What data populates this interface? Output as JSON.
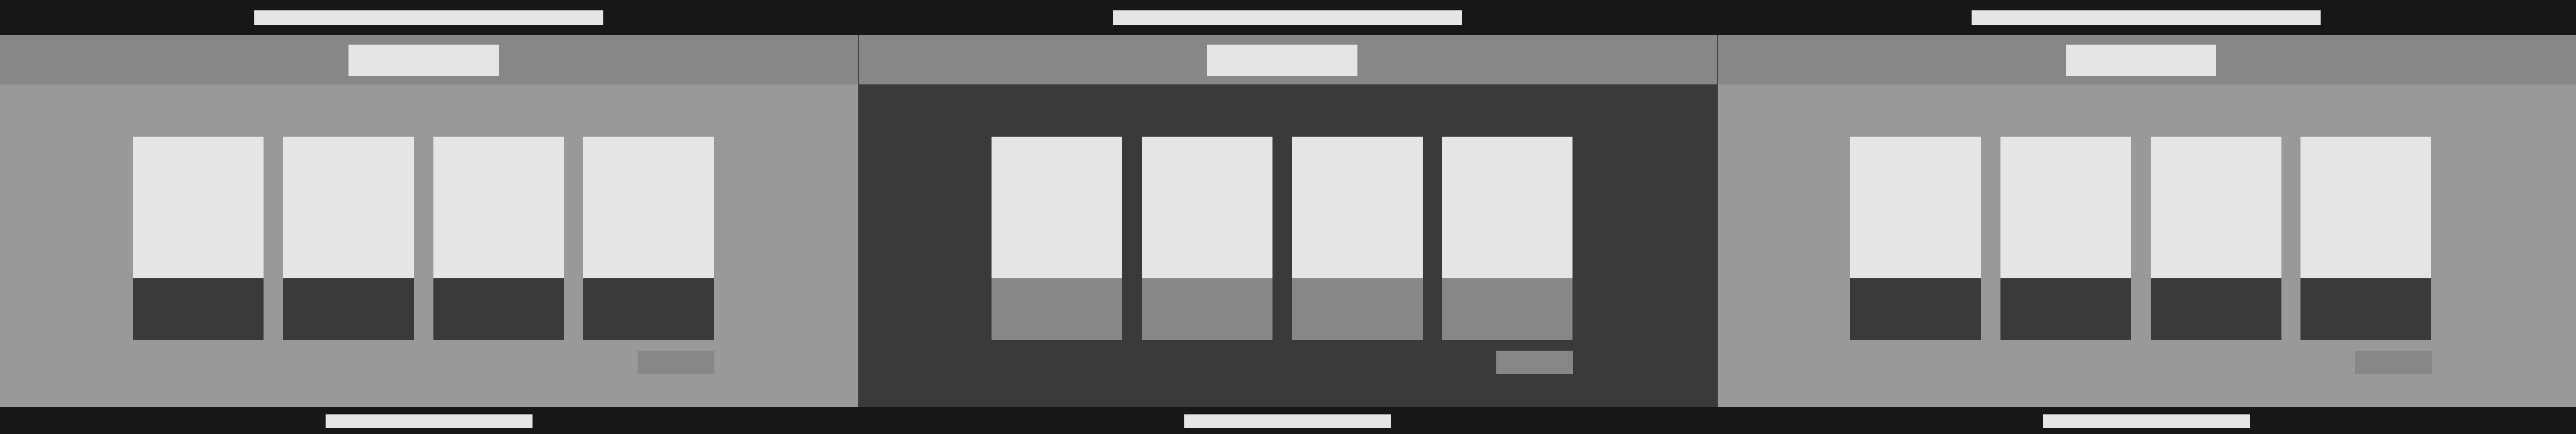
{
  "panels": [
    {
      "content_bg": "#999999",
      "card_footer_bg": "#3a3a3a",
      "card_count": 4
    },
    {
      "content_bg": "#3a3a3a",
      "card_footer_bg": "#878787",
      "card_count": 4
    },
    {
      "content_bg": "#999999",
      "card_footer_bg": "#3a3a3a",
      "card_count": 4
    }
  ],
  "colors": {
    "bar_dark": "#171717",
    "header_band": "#878787",
    "placeholder_light": "#e5e5e5",
    "button_gray": "#878787"
  }
}
